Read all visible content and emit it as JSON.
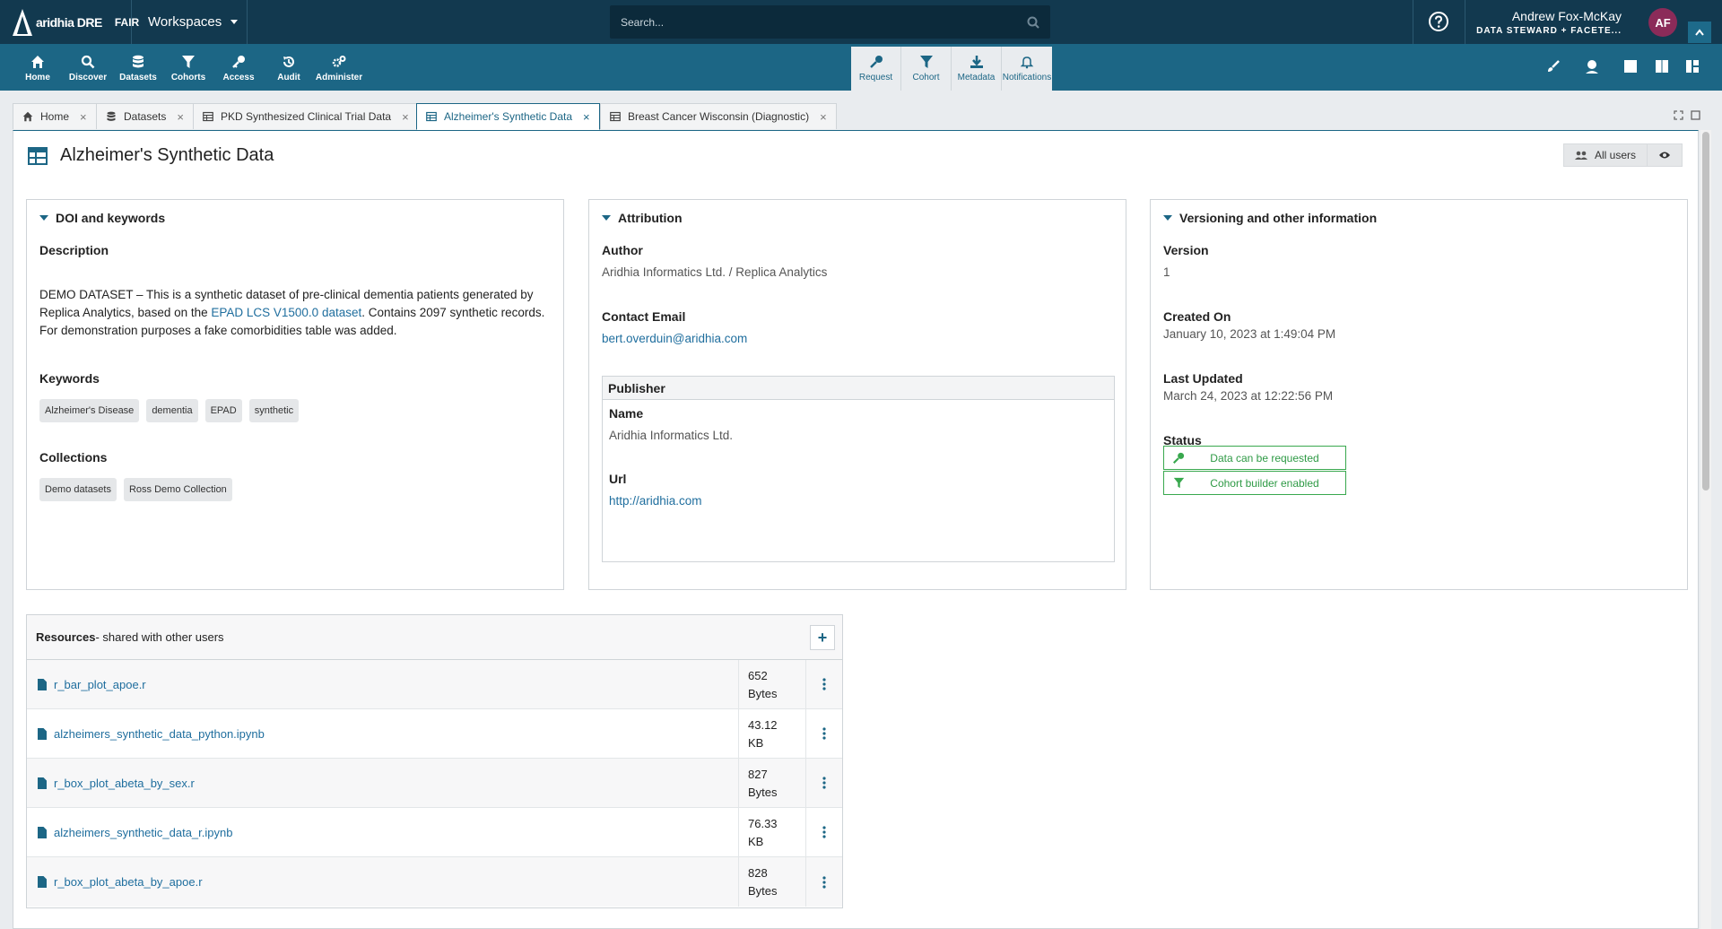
{
  "app": {
    "logo_text": "aridhia DRE",
    "logo_fair": "FAIR",
    "workspaces_label": "Workspaces",
    "search_placeholder": "Search...",
    "user_name": "Andrew Fox-McKay",
    "user_role": "DATA STEWARD + FACETE...",
    "user_initials": "AF"
  },
  "nav": [
    {
      "label": "Home",
      "icon": "home-icon"
    },
    {
      "label": "Discover",
      "icon": "search-icon"
    },
    {
      "label": "Datasets",
      "icon": "database-icon"
    },
    {
      "label": "Cohorts",
      "icon": "filter-icon"
    },
    {
      "label": "Access",
      "icon": "key-icon"
    },
    {
      "label": "Audit",
      "icon": "history-icon"
    },
    {
      "label": "Administer",
      "icon": "cogs-icon"
    }
  ],
  "tools": [
    {
      "label": "Request",
      "icon": "key-icon"
    },
    {
      "label": "Cohort",
      "icon": "filter-icon"
    },
    {
      "label": "Metadata",
      "icon": "download-icon"
    },
    {
      "label": "Notifications",
      "icon": "bell-icon"
    }
  ],
  "tabs": [
    {
      "label": "Home"
    },
    {
      "label": "Datasets"
    },
    {
      "label": "PKD Synthesized Clinical Trial Data"
    },
    {
      "label": "Alzheimer's Synthetic Data"
    },
    {
      "label": "Breast Cancer Wisconsin (Diagnostic)"
    }
  ],
  "page": {
    "title": "Alzheimer's Synthetic Data",
    "all_users_label": "All users"
  },
  "doi": {
    "heading": "DOI and keywords",
    "description_label": "Description",
    "description_before": "DEMO DATASET – This is a synthetic dataset of pre-clinical dementia patients generated by Replica Analytics, based on the ",
    "description_link": "EPAD LCS V1500.0 dataset",
    "description_after": ". Contains 2097 synthetic records. For demonstration purposes a fake comorbidities table was added.",
    "keywords_label": "Keywords",
    "keywords": [
      "Alzheimer's Disease",
      "dementia",
      "EPAD",
      "synthetic"
    ],
    "collections_label": "Collections",
    "collections": [
      "Demo datasets",
      "Ross Demo Collection"
    ]
  },
  "attribution": {
    "heading": "Attribution",
    "author_label": "Author",
    "author": "Aridhia Informatics Ltd. / Replica Analytics",
    "email_label": "Contact Email",
    "email": "bert.overduin@aridhia.com",
    "publisher_label": "Publisher",
    "name_label": "Name",
    "name": "Aridhia Informatics Ltd.",
    "url_label": "Url",
    "url": "http://aridhia.com"
  },
  "versioning": {
    "heading": "Versioning and other information",
    "version_label": "Version",
    "version": "1",
    "created_label": "Created On",
    "created": "January 10, 2023 at 1:49:04 PM",
    "updated_label": "Last Updated",
    "updated": "March 24, 2023 at 12:22:56 PM",
    "status_label": "Status",
    "status_requested": "Data can be requested",
    "status_cohort": "Cohort builder enabled",
    "status_color": "#39a84e"
  },
  "resources": {
    "title": "Resources",
    "subtitle": " - shared with other users",
    "items": [
      {
        "name": "r_bar_plot_apoe.r",
        "size_num": "652",
        "size_unit": "Bytes"
      },
      {
        "name": "alzheimers_synthetic_data_python.ipynb",
        "size_num": "43.12",
        "size_unit": "KB"
      },
      {
        "name": "r_box_plot_abeta_by_sex.r",
        "size_num": "827",
        "size_unit": "Bytes"
      },
      {
        "name": "alzheimers_synthetic_data_r.ipynb",
        "size_num": "76.33",
        "size_unit": "KB"
      },
      {
        "name": "r_box_plot_abeta_by_apoe.r",
        "size_num": "828",
        "size_unit": "Bytes"
      }
    ]
  },
  "colors": {
    "topbar": "#12394f",
    "navbar": "#1c6685",
    "link": "#1f6e9e"
  }
}
